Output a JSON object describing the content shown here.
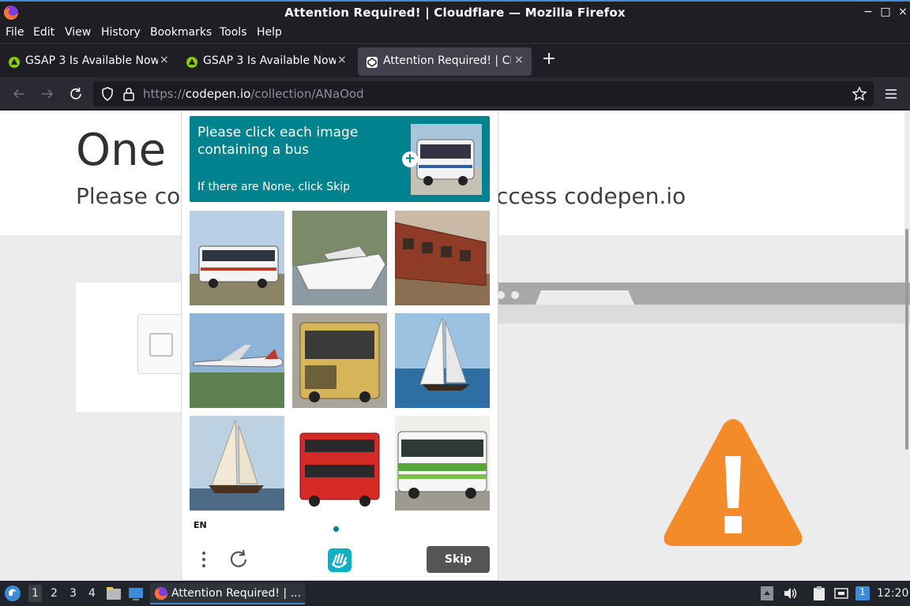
{
  "window": {
    "title": "Attention Required! | Cloudflare — Mozilla Firefox",
    "controls": {
      "minimize": "−",
      "maximize": "□",
      "close": "×"
    }
  },
  "menubar": [
    "File",
    "Edit",
    "View",
    "History",
    "Bookmarks",
    "Tools",
    "Help"
  ],
  "tabs": [
    {
      "label": "GSAP 3 Is Available Now!",
      "close": "×",
      "active": false
    },
    {
      "label": "GSAP 3 Is Available Now!",
      "close": "×",
      "active": false
    },
    {
      "label": "Attention Required! | Cloudflare",
      "close": "×",
      "active": true
    }
  ],
  "newtab_label": "+",
  "url": {
    "scheme": "https://",
    "host": "codepen.io",
    "path": "/collection/ANaOod"
  },
  "page": {
    "heading": "One more step",
    "subtitle": "Please complete the security check to access codepen.io",
    "subtitle_visible_left": "Please con",
    "subtitle_visible_right": "ccess codepen.io",
    "heading_visible": "One r"
  },
  "captcha": {
    "prompt": "Please click each image containing a bus",
    "hint": "If there are None, click Skip",
    "language": "EN",
    "skip_label": "Skip",
    "tiles": [
      {
        "subject": "bus"
      },
      {
        "subject": "boat"
      },
      {
        "subject": "train"
      },
      {
        "subject": "airplane"
      },
      {
        "subject": "bus"
      },
      {
        "subject": "sailboat"
      },
      {
        "subject": "sailboat"
      },
      {
        "subject": "bus"
      },
      {
        "subject": "bus"
      }
    ],
    "accent_color": "#00838f"
  },
  "taskbar": {
    "workspaces": [
      "1",
      "2",
      "3",
      "4"
    ],
    "active_workspace": "1",
    "app_label": "Attention Required! | ...",
    "clock": "12:20",
    "notification_count": "1"
  }
}
